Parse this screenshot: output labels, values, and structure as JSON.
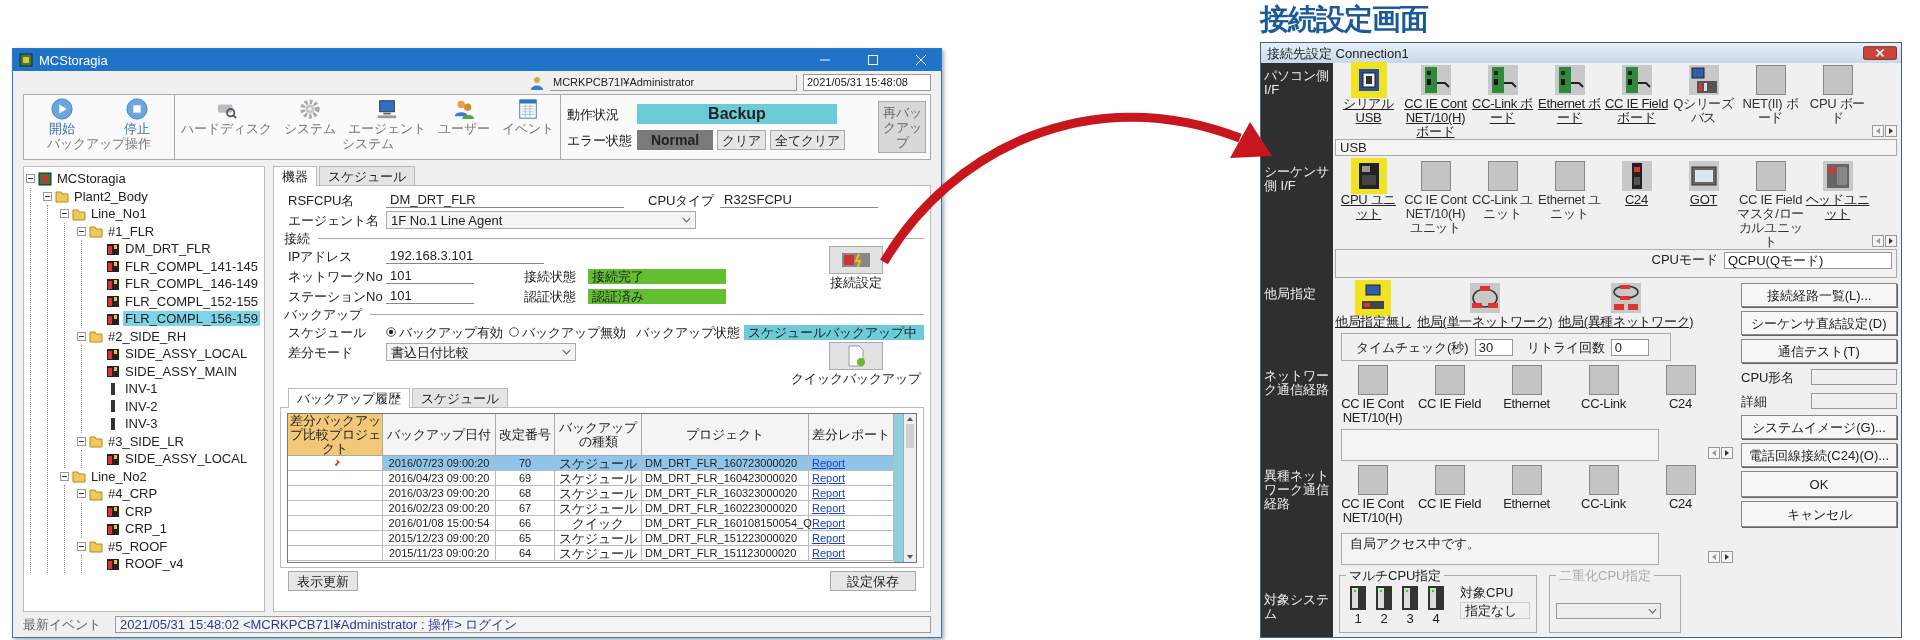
{
  "monitor_window": {
    "title": "MCStoragia",
    "user": "MCRKPCB71I¥Administrator",
    "datetime": "2021/05/31 15:48:08",
    "toolbar": [
      {
        "label": "バックアップ操作",
        "buttons": [
          {
            "label": "開始",
            "kind": "play"
          },
          {
            "label": "停止",
            "kind": "stop"
          }
        ]
      },
      {
        "label": "システム",
        "buttons": [
          {
            "label": "ハードディスク",
            "kind": "disk"
          },
          {
            "label": "システム",
            "kind": "gear"
          },
          {
            "label": "エージェント",
            "kind": "monitor"
          },
          {
            "label": "ユーザー",
            "kind": "users"
          },
          {
            "label": "イベント",
            "kind": "list"
          }
        ]
      }
    ],
    "status": {
      "operation_label": "動作状況",
      "operation": "Backup",
      "error_label": "エラー状態",
      "error": "Normal",
      "clear": "クリア",
      "clear_all": "全てクリア",
      "rebackup": "再バックアップ"
    },
    "tree": [
      {
        "label": "MCStoragia",
        "kind": "root",
        "selected": false,
        "expanded": true,
        "children": [
          {
            "label": "Plant2_Body",
            "kind": "folder",
            "selected": false,
            "expanded": true,
            "children": [
              {
                "label": "Line_No1",
                "kind": "folder",
                "selected": false,
                "expanded": true,
                "children": [
                  {
                    "label": "#1_FLR",
                    "kind": "folder",
                    "selected": false,
                    "expanded": true,
                    "children": [
                      {
                        "label": "DM_DRT_FLR",
                        "kind": "plc",
                        "selected": false
                      },
                      {
                        "label": "FLR_COMPL_141-145",
                        "kind": "plc",
                        "selected": false
                      },
                      {
                        "label": "FLR_COMPL_146-149",
                        "kind": "plc",
                        "selected": false
                      },
                      {
                        "label": "FLR_COMPL_152-155",
                        "kind": "plc",
                        "selected": false
                      },
                      {
                        "label": "FLR_COMPL_156-159",
                        "kind": "plc",
                        "selected": true
                      }
                    ]
                  },
                  {
                    "label": "#2_SIDE_RH",
                    "kind": "folder",
                    "selected": false,
                    "expanded": true,
                    "children": [
                      {
                        "label": "SIDE_ASSY_LOCAL",
                        "kind": "plc",
                        "selected": false
                      },
                      {
                        "label": "SIDE_ASSY_MAIN",
                        "kind": "plc",
                        "selected": false
                      },
                      {
                        "label": "INV-1",
                        "kind": "inverter",
                        "selected": false
                      },
                      {
                        "label": "INV-2",
                        "kind": "inverter",
                        "selected": false
                      },
                      {
                        "label": "INV-3",
                        "kind": "inverter",
                        "selected": false
                      }
                    ]
                  },
                  {
                    "label": "#3_SIDE_LR",
                    "kind": "folder",
                    "selected": false,
                    "expanded": true,
                    "children": [
                      {
                        "label": "SIDE_ASSY_LOCAL",
                        "kind": "plc",
                        "selected": false
                      }
                    ]
                  }
                ]
              },
              {
                "label": "Line_No2",
                "kind": "folder",
                "selected": false,
                "expanded": true,
                "children": [
                  {
                    "label": "#4_CRP",
                    "kind": "folder",
                    "selected": false,
                    "expanded": true,
                    "children": [
                      {
                        "label": "CRP",
                        "kind": "plc",
                        "selected": false
                      },
                      {
                        "label": "CRP_1",
                        "kind": "plc",
                        "selected": false
                      }
                    ]
                  },
                  {
                    "label": "#5_ROOF",
                    "kind": "folder",
                    "selected": false,
                    "expanded": true,
                    "children": [
                      {
                        "label": "ROOF_v4",
                        "kind": "plc",
                        "selected": false
                      }
                    ]
                  }
                ]
              }
            ]
          }
        ]
      }
    ],
    "tabs": [
      {
        "label": "機器",
        "selected": true
      },
      {
        "label": "スケジュール",
        "selected": false
      }
    ],
    "device": {
      "cpu_name_label": "RSFCPU名",
      "cpu_name": "DM_DRT_FLR",
      "cpu_type_label": "CPUタイプ",
      "cpu_type": "R32SFCPU",
      "agent_label": "エージェント名",
      "agent": "1F No.1 Line Agent",
      "connection_heading": "接続",
      "ip_label": "IPアドレス",
      "ip": "192.168.3.101",
      "network_label": "ネットワークNo",
      "network": "101",
      "station_label": "ステーションNo",
      "station": "101",
      "conn_state_label": "接続状態",
      "conn_state": "接続完了",
      "auth_state_label": "認証状態",
      "auth_state": "認証済み",
      "connect_button": "接続設定",
      "backup_heading": "バックアップ",
      "schedule_label": "スケジュール",
      "schedule_options": [
        {
          "label": "バックアップ有効",
          "selected": true
        },
        {
          "label": "バックアップ無効",
          "selected": false
        }
      ],
      "backup_state_label": "バックアップ状態",
      "backup_state": "スケジュールバックアップ中",
      "diff_label": "差分モード",
      "diff_mode": "書込日付比較",
      "quick_button": "クイックバックアップ"
    },
    "history_tabs": [
      {
        "label": "バックアップ履歴",
        "selected": true
      },
      {
        "label": "スケジュール",
        "selected": false
      }
    ],
    "table": {
      "columns": [
        "差分バックアップ比較プロジェクト",
        "バックアップ日付",
        "改定番号",
        "バックアップの種類",
        "プロジェクト",
        "差分レポート"
      ],
      "rows": [
        {
          "pinned": true,
          "selected": true,
          "cells": [
            "",
            "2016/07/23 09:00:20",
            "70",
            "スケジュール",
            "DM_DRT_FLR_160723000020",
            "Report"
          ]
        },
        {
          "pinned": false,
          "selected": false,
          "cells": [
            "",
            "2016/04/23 09:00:20",
            "69",
            "スケジュール",
            "DM_DRT_FLR_160423000020",
            "Report"
          ]
        },
        {
          "pinned": false,
          "selected": false,
          "cells": [
            "",
            "2016/03/23 09:00:20",
            "68",
            "スケジュール",
            "DM_DRT_FLR_160323000020",
            "Report"
          ]
        },
        {
          "pinned": false,
          "selected": false,
          "cells": [
            "",
            "2016/02/23 09:00:20",
            "67",
            "スケジュール",
            "DM_DRT_FLR_160223000020",
            "Report"
          ]
        },
        {
          "pinned": false,
          "selected": false,
          "cells": [
            "",
            "2016/01/08 15:00:54",
            "66",
            "クイック",
            "DM_DRT_FLR_160108150054_Q",
            "Report"
          ]
        },
        {
          "pinned": false,
          "selected": false,
          "cells": [
            "",
            "2015/12/23 09:00:20",
            "65",
            "スケジュール",
            "DM_DRT_FLR_151223000020",
            "Report"
          ]
        },
        {
          "pinned": false,
          "selected": false,
          "cells": [
            "",
            "2015/11/23 09:00:20",
            "64",
            "スケジュール",
            "DM_DRT_FLR_151123000020",
            "Report"
          ]
        }
      ]
    },
    "refresh_button": "表示更新",
    "save_button": "設定保存",
    "status_bar": {
      "label": "最新イベント",
      "text": "2021/05/31 15:48:02  <MCRKPCB71I¥Administrator : 操作>  ログイン"
    }
  },
  "connection_title": "接続設定画面",
  "connection_window": {
    "title": "接続先設定 Connection1",
    "pc_if": {
      "label": "パソコン側 I/F",
      "items": [
        {
          "label": "シリアル USB",
          "kind": "usb",
          "enabled": true,
          "selected": true
        },
        {
          "label": "CC IE Cont NET/10(H) ボード",
          "kind": "board",
          "enabled": true,
          "selected": false
        },
        {
          "label": "CC-Link ボード",
          "kind": "board",
          "enabled": true,
          "selected": false
        },
        {
          "label": "Ethernet ボード",
          "kind": "board",
          "enabled": true,
          "selected": false
        },
        {
          "label": "CC IE Field ボード",
          "kind": "board",
          "enabled": true,
          "selected": false
        },
        {
          "label": "Qシリーズバス",
          "kind": "bus",
          "enabled": false,
          "selected": false
        },
        {
          "label": "NET(II) ボード",
          "kind": "blank",
          "enabled": false,
          "selected": false
        },
        {
          "label": "CPU ボード",
          "kind": "blank",
          "enabled": false,
          "selected": false
        }
      ],
      "value": "USB"
    },
    "plc_if": {
      "label": "シーケンサ側 I/F",
      "items": [
        {
          "label": "CPU ユニット",
          "kind": "cpu",
          "enabled": true,
          "selected": true
        },
        {
          "label": "CC IE Cont NET/10(H) ユニット",
          "kind": "blank",
          "enabled": false,
          "selected": false
        },
        {
          "label": "CC-Link ユニット",
          "kind": "blank",
          "enabled": false,
          "selected": false
        },
        {
          "label": "Ethernet ユニット",
          "kind": "blank",
          "enabled": false,
          "selected": false
        },
        {
          "label": "C24",
          "kind": "c24",
          "enabled": true,
          "selected": false
        },
        {
          "label": "GOT",
          "kind": "got",
          "enabled": true,
          "selected": false
        },
        {
          "label": "CC IE Field マスタ/ローカルユニット",
          "kind": "blank",
          "enabled": false,
          "selected": false
        },
        {
          "label": "ヘッドユニット",
          "kind": "head",
          "enabled": true,
          "selected": false
        }
      ],
      "cpu_mode_label": "CPUモード",
      "cpu_mode": "QCPU(Qモード)"
    },
    "other_station": {
      "label": "他局指定",
      "items": [
        {
          "label": "他局指定無し",
          "kind": "local",
          "enabled": true,
          "selected": true
        },
        {
          "label": "他局(単一ネットワーク)",
          "kind": "single",
          "enabled": true,
          "selected": false
        },
        {
          "label": "他局(異種ネットワーク)",
          "kind": "multi",
          "enabled": true,
          "selected": false
        }
      ],
      "timecheck_label": "タイムチェック(秒)",
      "timecheck": "30",
      "retry_label": "リトライ回数",
      "retry": "0"
    },
    "network_route": {
      "label": "ネットワーク通信経路",
      "items": [
        "CC IE Cont NET/10(H)",
        "CC IE Field",
        "Ethernet",
        "CC-Link",
        "C24"
      ]
    },
    "hetero_route": {
      "label": "異種ネットワーク通信経路",
      "items": [
        "CC IE Cont NET/10(H)",
        "CC IE Field",
        "Ethernet",
        "CC-Link",
        "C24"
      ]
    },
    "message": "自局アクセス中です。",
    "target_system": {
      "label": "対象システム",
      "multi_cpu_label": "マルチCPU指定",
      "cpus": [
        "1",
        "2",
        "3",
        "4"
      ],
      "target_cpu_label": "対象CPU",
      "target_cpu": "指定なし",
      "redundant_label": "二重化CPU指定",
      "redundant_disabled": true
    },
    "side_buttons": {
      "route_list": "接続経路一覧(L)...",
      "direct": "シーケンサ直結設定(D)",
      "test": "通信テスト(T)",
      "cpu_model_label": "CPU形名",
      "detail_label": "詳細",
      "system_image": "システムイメージ(G)...",
      "phone": "電話回線接続(C24)(O)...",
      "ok": "OK",
      "cancel": "キャンセル"
    }
  }
}
